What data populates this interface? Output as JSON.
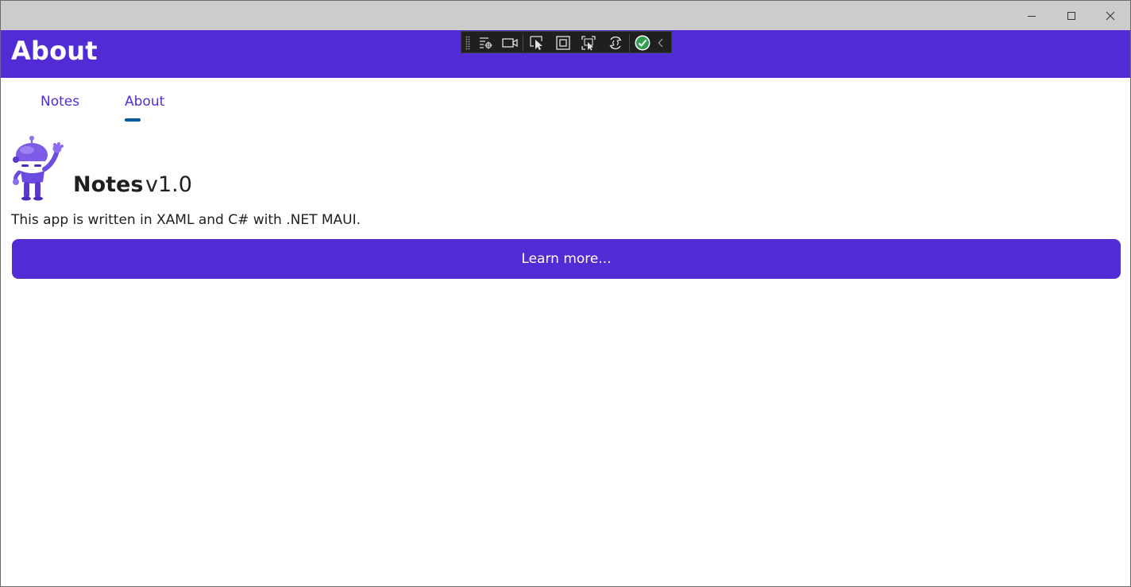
{
  "window": {
    "minimize_icon": "minimize-icon",
    "maximize_icon": "maximize-icon",
    "close_icon": "close-icon"
  },
  "header": {
    "title": "About",
    "background": "#512bd4"
  },
  "debug_toolbar": {
    "items": [
      "live-visual-tree-icon",
      "record-icon",
      "select-element-icon",
      "display-layout-adorners-icon",
      "track-focused-element-icon",
      "hot-reload-icon",
      "binding-status-icon",
      "collapse-chevron-icon"
    ]
  },
  "tabs": {
    "items": [
      {
        "label": "Notes"
      },
      {
        "label": "About"
      }
    ],
    "selected": "About",
    "indicator_color": "#005a9e"
  },
  "about": {
    "app_name": "Notes",
    "version": "v1.0",
    "description": "This app is written in XAML and C# with .NET MAUI.",
    "learn_more_label": "Learn more...",
    "logo_icon": "dotnet-bot-icon"
  }
}
